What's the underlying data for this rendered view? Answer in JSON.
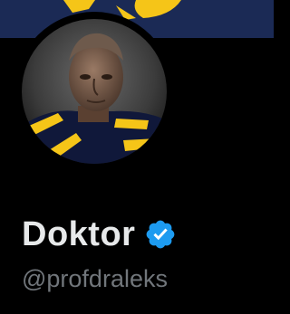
{
  "profile": {
    "display_name": "Doktor",
    "handle": "@profdraleks",
    "verified_icon": "verified-badge-icon"
  },
  "colors": {
    "background": "#000000",
    "banner": "#1b2a55",
    "banner_accent": "#f5c518",
    "display_name": "#e7e9ea",
    "handle": "#71767b",
    "verified": "#1d9bf0"
  }
}
